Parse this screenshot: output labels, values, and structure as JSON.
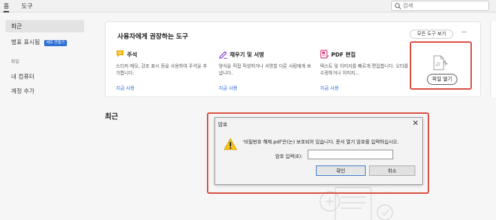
{
  "tabs": {
    "home": "홈",
    "tools": "도구"
  },
  "search": {
    "placeholder": "검색",
    "icon": "search-icon"
  },
  "sidebar": {
    "recent": "최근",
    "starred": "별표 표시됨",
    "new_badge": "새로 만들기",
    "files_section": "파일",
    "my_computer": "내 컴퓨터",
    "add_account": "계정 추가"
  },
  "recommended": {
    "title": "사용자에게 권장하는 도구",
    "all_tools_label": "모든 도구 보기",
    "more_label": "···",
    "tools": [
      {
        "name": "주석",
        "icon": "comment-icon",
        "icon_color": "#f5b000",
        "desc": "스티커 메모, 강조 표시 등을 사용하여 주석을 추가합니다.",
        "link": "지금 사용"
      },
      {
        "name": "채우기 및 서명",
        "icon": "fill-sign-pen-icon",
        "icon_color": "#8a4fd6",
        "desc": "양식을 직접 작성하거나 서명할 다른 사람에게 보냅니다.",
        "link": "지금 사용"
      },
      {
        "name": "PDF 편집",
        "icon": "edit-pdf-icon",
        "icon_color": "#e0367a",
        "desc": "텍스트 및 이미지를 빠르게 편집합니다. 오타를 수정하거나 이미지...",
        "link": "지금 사용"
      }
    ],
    "open_file_label": "파일 열기"
  },
  "recent_heading": "최근",
  "dialog": {
    "title": "암호",
    "message": "'비밀번호 해제.pdf'은(는) 보호되어 있습니다. 문서 열기 암호를 입력하십시오.",
    "password_label": "암호 입력(E):",
    "password_value": "",
    "ok_label": "확인",
    "cancel_label": "취소",
    "close_glyph": "✕"
  },
  "colors": {
    "accent_blue": "#2f6fd6",
    "highlight_red": "#d9473b",
    "dialog_focus_blue": "#3b79cc"
  }
}
